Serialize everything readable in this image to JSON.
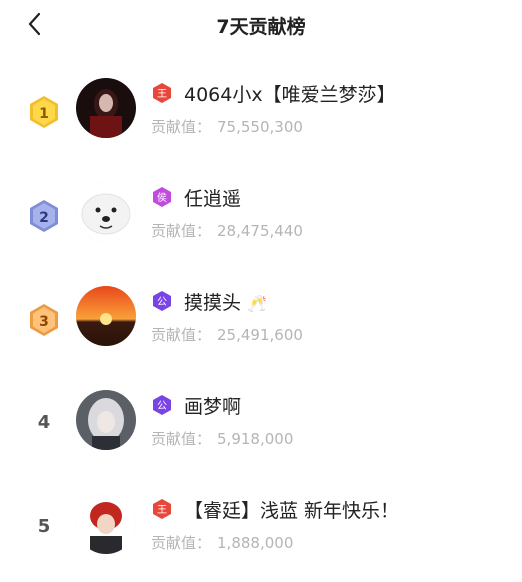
{
  "header": {
    "title": "7天贡献榜",
    "back_icon": "chevron-left-icon"
  },
  "colors": {
    "gold": "#F2BE2E",
    "silver": "#7F8DD6",
    "bronze": "#EE9C43",
    "king_badge": "#E8483A",
    "duke_badge": "#7A43E6",
    "marquis_badge": "#C14BE0",
    "contrib_text": "#B5B5B5"
  },
  "list": [
    {
      "rank": "1",
      "badge": "王",
      "name": "4064小x【唯爱兰梦莎】",
      "contrib_label": "贡献值：",
      "contrib_value": "75,550,300"
    },
    {
      "rank": "2",
      "badge": "侯",
      "name": "任逍遥",
      "contrib_label": "贡献值：",
      "contrib_value": "28,475,440"
    },
    {
      "rank": "3",
      "badge": "公",
      "name": "摸摸头",
      "emoji": "🥂",
      "contrib_label": "贡献值：",
      "contrib_value": "25,491,600"
    },
    {
      "rank": "4",
      "badge": "公",
      "name": "画梦啊",
      "contrib_label": "贡献值：",
      "contrib_value": "5,918,000"
    },
    {
      "rank": "5",
      "badge": "王",
      "name": "【睿廷】浅蓝 新年快乐！",
      "contrib_label": "贡献值：",
      "contrib_value": "1,888,000"
    }
  ]
}
